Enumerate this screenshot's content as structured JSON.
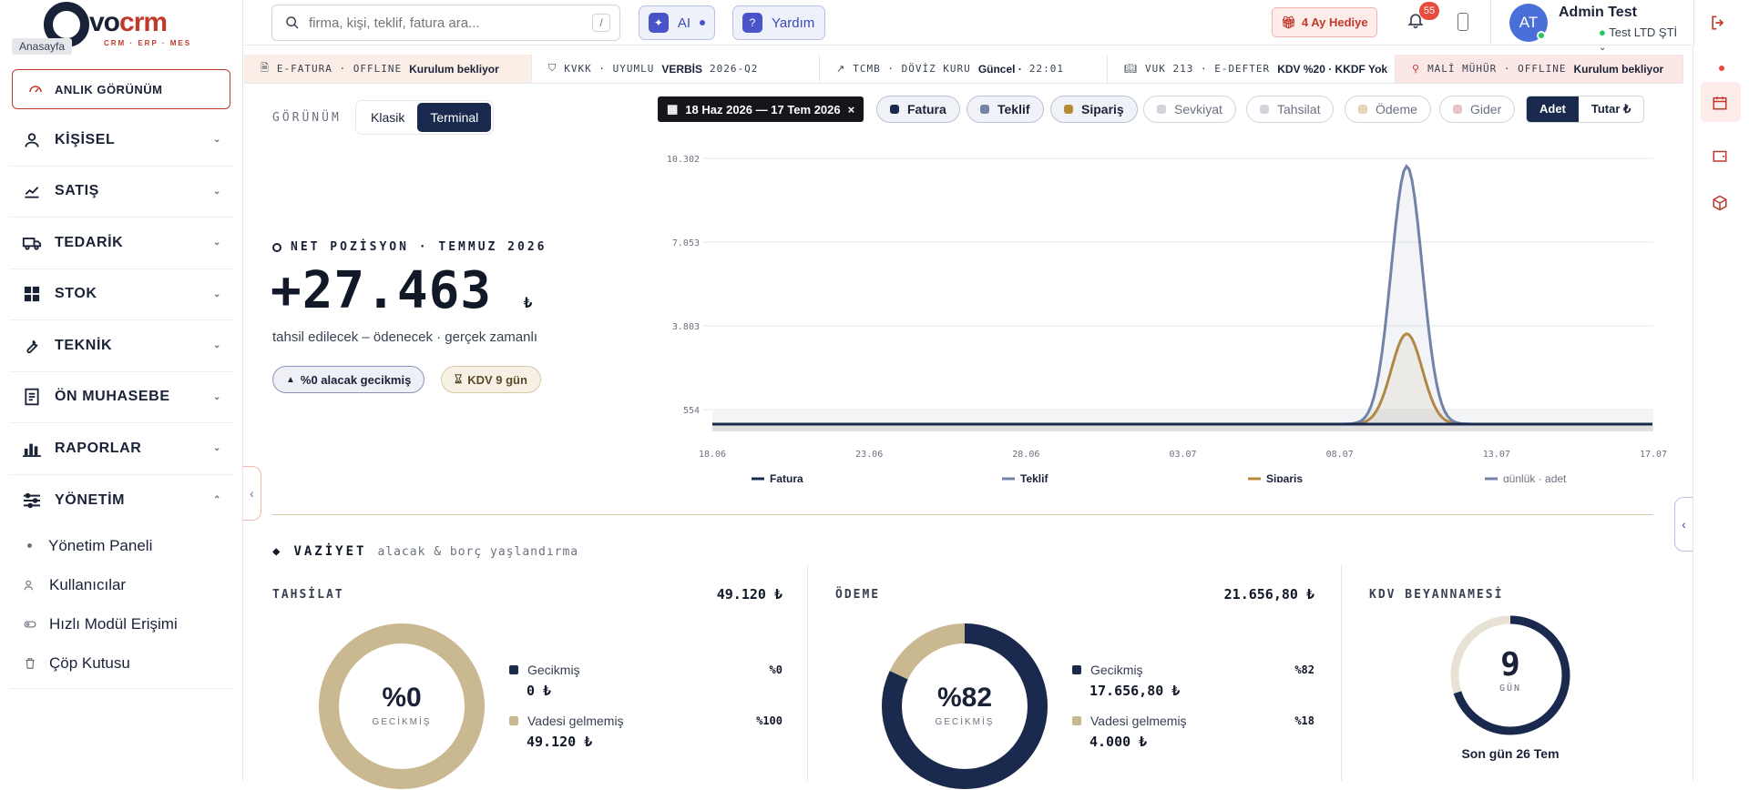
{
  "brand": {
    "logo_text": "vo",
    "logo_accent": "crm",
    "tagline": "CRM · ERP · MES"
  },
  "tooltip": "Anasayfa",
  "home_button": "ANLIK GÖRÜNÜM",
  "nav": [
    {
      "label": "KİŞİSEL",
      "icon": "user-icon"
    },
    {
      "label": "SATIŞ",
      "icon": "trend-icon"
    },
    {
      "label": "TEDARİK",
      "icon": "truck-icon"
    },
    {
      "label": "STOK",
      "icon": "grid-icon"
    },
    {
      "label": "TEKNİK",
      "icon": "wrench-icon"
    },
    {
      "label": "ÖN MUHASEBE",
      "icon": "ledger-icon"
    },
    {
      "label": "RAPORLAR",
      "icon": "bar-chart-icon"
    },
    {
      "label": "YÖNETİM",
      "icon": "sliders-icon"
    }
  ],
  "subnav": [
    "Yönetim Paneli",
    "Kullanıcılar",
    "Hızlı Modül Erişimi",
    "Çöp Kutusu"
  ],
  "search": {
    "placeholder": "firma, kişi, teklif, fatura ara...",
    "shortcut": "/"
  },
  "ai_label": "AI",
  "help_label": "Yardım",
  "gift_label": "4 Ay Hediye",
  "notif_count": "55",
  "user": {
    "initials": "AT",
    "name": "Admin Test",
    "company": "Test LTD ŞTİ"
  },
  "status": [
    {
      "key": "E-FATURA · OFFLINE",
      "val": "Kurulum bekliyor"
    },
    {
      "key": "KVKK · UYUMLU",
      "val": "VERBİS",
      "extra": "2026-Q2"
    },
    {
      "key": "TCMB · DÖVİZ KURU",
      "val": "Güncel ·",
      "extra": "22:01"
    },
    {
      "key": "VUK 213 · E-DEFTER",
      "val": "KDV %20 · KKDF Yok"
    },
    {
      "key": "MALİ MÜHÜR · OFFLINE",
      "val": "Kurulum bekliyor"
    }
  ],
  "view": {
    "label": "GÖRÜNÜM",
    "options": [
      "Klasik",
      "Terminal"
    ],
    "active": "Terminal"
  },
  "net": {
    "title": "NET POZİSYON · TEMMUZ 2026",
    "value": "+27.463",
    "currency": "₺",
    "subtitle": "tahsil edilecek – ödenecek · gerçek zamanlı",
    "pill1": "%0 alacak gecikmiş",
    "pill2": "KDV 9 gün"
  },
  "date_range": "18 Haz 2026 — 17 Tem 2026",
  "filters": [
    {
      "label": "Fatura",
      "on": true,
      "color": "#1a2a4f"
    },
    {
      "label": "Teklif",
      "on": true,
      "color": "#7282a8"
    },
    {
      "label": "Sipariş",
      "on": true,
      "color": "#b8893a"
    },
    {
      "label": "Sevkiyat",
      "on": false,
      "color": "#d1d5db"
    },
    {
      "label": "Tahsilat",
      "on": false,
      "color": "#d1d5db"
    },
    {
      "label": "Ödeme",
      "on": false,
      "color": "#e6d6b8"
    },
    {
      "label": "Gider",
      "on": false,
      "color": "#e6c4c4"
    }
  ],
  "unit_toggle": [
    "Adet",
    "Tutar ₺"
  ],
  "chart_data": {
    "type": "line",
    "x_ticks": [
      "18.06",
      "23.06",
      "28.06",
      "03.07",
      "08.07",
      "13.07",
      "17.07"
    ],
    "y_ticks": [
      "10.302",
      "7.053",
      "3.803",
      "554"
    ],
    "ylim": [
      0,
      10302
    ],
    "series": [
      {
        "name": "Fatura",
        "color": "#1a2a4f",
        "peak": 0,
        "base": 0
      },
      {
        "name": "Teklif",
        "color": "#7282a8",
        "peak": 9700,
        "base": 0
      },
      {
        "name": "Sipariş",
        "color": "#b8893a",
        "peak": 3400,
        "base": 0
      }
    ],
    "legend_note": "günlük · adet"
  },
  "vaziyet": {
    "title": "VAZİYET",
    "subtitle": "alacak & borç yaşlandırma"
  },
  "cards": [
    {
      "title": "TAHSİLAT",
      "total": "49.120 ₺",
      "pct": "%0",
      "pct_label": "GECİKMİŞ",
      "overdue_fraction": 0,
      "rows": [
        {
          "label": "Gecikmiş",
          "value": "0 ₺",
          "pct": "%0"
        },
        {
          "label": "Vadesi gelmemiş",
          "value": "49.120 ₺",
          "pct": "%100"
        }
      ]
    },
    {
      "title": "ÖDEME",
      "total": "21.656,80 ₺",
      "pct": "%82",
      "pct_label": "GECİKMİŞ",
      "overdue_fraction": 0.82,
      "rows": [
        {
          "label": "Gecikmiş",
          "value": "17.656,80 ₺",
          "pct": "%82"
        },
        {
          "label": "Vadesi gelmemiş",
          "value": "4.000 ₺",
          "pct": "%18"
        }
      ]
    },
    {
      "title": "KDV BEYANNAMESİ",
      "days": "9",
      "days_label": "GÜN",
      "deadline": "Son gün 26 Tem",
      "progress_fraction": 0.7
    }
  ]
}
